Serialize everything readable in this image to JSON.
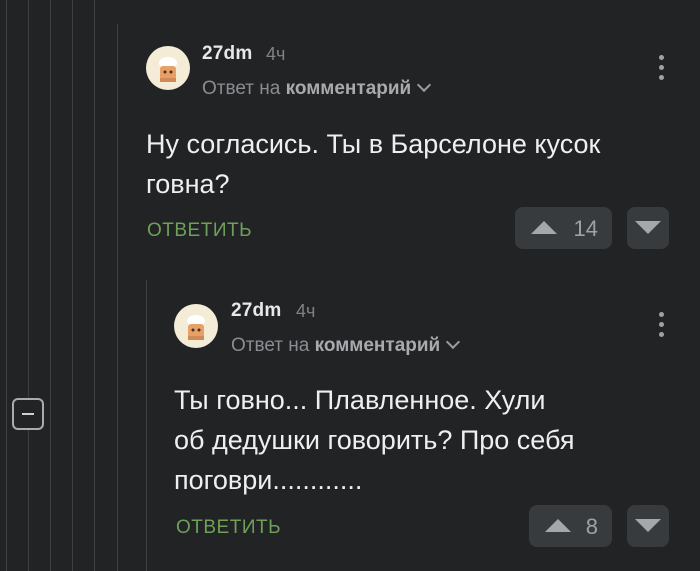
{
  "collapse": {
    "icon": "minus-square-icon"
  },
  "comments": [
    {
      "username": "27dm",
      "time": "4ч",
      "reply_prefix": "Ответ на",
      "reply_target": "комментарий",
      "text_lines": [
        "Ну согласись. Ты в Барселоне кусок",
        "говна?"
      ],
      "reply_label": "ОТВЕТИТЬ",
      "rating": "14"
    },
    {
      "username": "27dm",
      "time": "4ч",
      "reply_prefix": "Ответ на",
      "reply_target": "комментарий",
      "text_lines": [
        "Ты говно... Плавленное. Хули",
        "об дедушки говорить? Про себя",
        "поговри............"
      ],
      "reply_label": "ОТВЕТИТЬ",
      "rating": "8"
    }
  ],
  "colors": {
    "background": "#212325",
    "accent_reply": "#6fa058",
    "vote_bg": "#383b3e"
  }
}
